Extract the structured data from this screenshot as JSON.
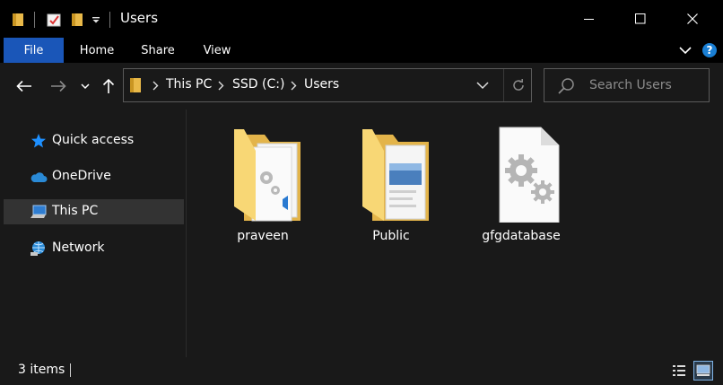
{
  "window": {
    "title": "Users",
    "controls": {
      "minimize": "minimize",
      "maximize": "maximize",
      "close": "close"
    }
  },
  "ribbon": {
    "tabs": [
      "File",
      "Home",
      "Share",
      "View"
    ],
    "file_color": "#1a56b8"
  },
  "address": {
    "breadcrumbs": [
      "This PC",
      "SSD (C:)",
      "Users"
    ]
  },
  "search": {
    "placeholder": "Search Users"
  },
  "nav": {
    "items": [
      {
        "label": "Quick access",
        "icon": "star-icon",
        "color": "#1e90ff"
      },
      {
        "label": "OneDrive",
        "icon": "cloud-icon",
        "color": "#2a8ad6"
      },
      {
        "label": "This PC",
        "icon": "computer-icon",
        "selected": true
      },
      {
        "label": "Network",
        "icon": "network-icon"
      }
    ]
  },
  "files": [
    {
      "name": "praveen",
      "type": "folder-with-documents"
    },
    {
      "name": "Public",
      "type": "folder-with-documents"
    },
    {
      "name": "gfgdatabase",
      "type": "system-file"
    }
  ],
  "status": {
    "item_count": "3 items"
  },
  "colors": {
    "background": "#191919",
    "titlebar": "#000000",
    "folder": "#f8d775",
    "selected_nav": "#333333"
  }
}
